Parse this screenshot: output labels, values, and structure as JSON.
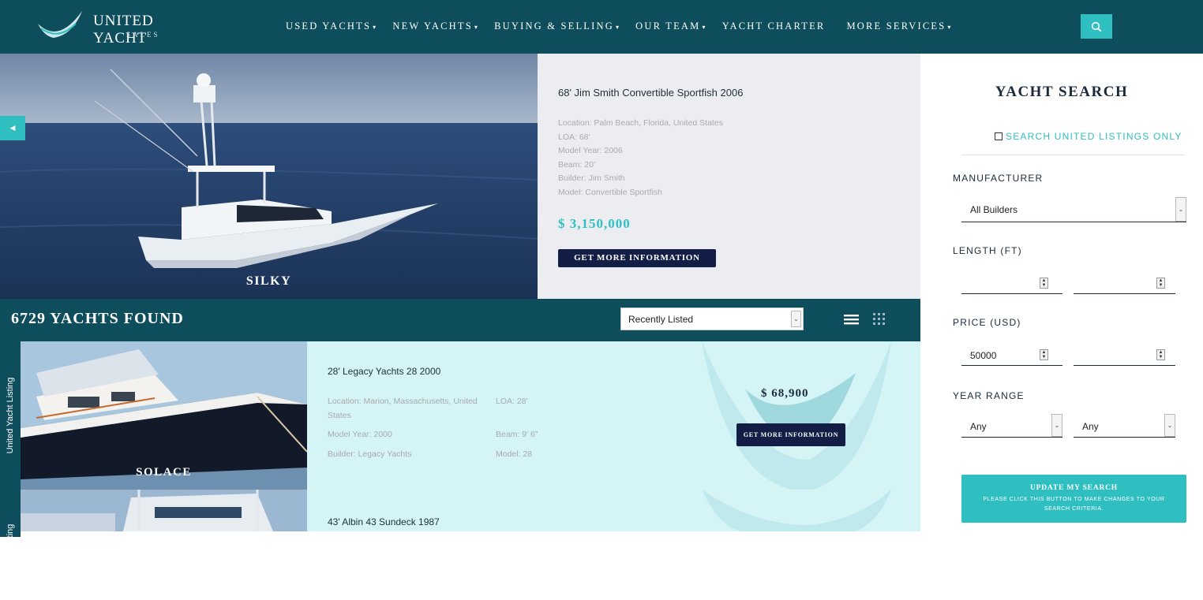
{
  "header": {
    "logo_text": "UNITED YACHT",
    "logo_sub": "SALES",
    "nav": [
      {
        "label": "USED YACHTS",
        "caret": "▾"
      },
      {
        "label": "NEW YACHTS",
        "caret": "▾"
      },
      {
        "label": "BUYING & SELLING",
        "caret": "▾"
      },
      {
        "label": "OUR TEAM",
        "caret": "▾"
      },
      {
        "label": "YACHT CHARTER",
        "caret": ""
      },
      {
        "label": "MORE SERVICES",
        "caret": "▾"
      }
    ],
    "search_icon": "search-icon"
  },
  "colors": {
    "navy": "#0d4d5c",
    "teal": "#2fbfc1",
    "dark_button": "#121e45",
    "card_bg": "#d4f4f6"
  },
  "hero": {
    "boat_name": "SILKY",
    "title": "68' Jim Smith Convertible Sportfish 2006",
    "specs": [
      "Location: Palm Beach, Florida, United States",
      "LOA: 68'",
      "Model Year: 2006",
      "Beam: 20'",
      "Builder: Jim Smith",
      "Model: Convertible Sportfish"
    ],
    "price": "$ 3,150,000",
    "cta": "GET MORE INFORMATION"
  },
  "results": {
    "count_text": "6729 YACHTS FOUND",
    "sort_value": "Recently Listed",
    "list_view_icon": "list-view-icon",
    "grid_view_icon": "grid-view-icon"
  },
  "listings": [
    {
      "tab": "United Yacht Listing",
      "name": "SOLACE",
      "title": "28' Legacy Yachts 28 2000",
      "location_1": "Location: Marion, Massachusetts, United",
      "location_2": "States",
      "loa": "LOA: 28'",
      "model_year": "Model Year: 2000",
      "beam": "Beam: 9'  6\"",
      "builder": "Builder: Legacy Yachts",
      "model": "Model: 28",
      "price": "$ 68,900",
      "cta": "GET MORE INFORMATION"
    },
    {
      "tab": "United Yacht Listing",
      "title": "43' Albin 43 Sundeck 1987"
    }
  ],
  "sidebar": {
    "title": "YACHT SEARCH",
    "united_only_label": "SEARCH UNITED LISTINGS ONLY",
    "manufacturer_label": "MANUFACTURER",
    "manufacturer_value": "All Builders",
    "length_label": "LENGTH (FT)",
    "length_min": "",
    "length_max": "",
    "price_label": "PRICE (USD)",
    "price_min": "50000",
    "price_max": "",
    "year_label": "YEAR RANGE",
    "year_min": "Any",
    "year_max": "Any",
    "update_title": "UPDATE MY SEARCH",
    "update_sub": "PLEASE CLICK THIS BUTTON TO MAKE CHANGES TO YOUR SEARCH CRITERIA."
  }
}
